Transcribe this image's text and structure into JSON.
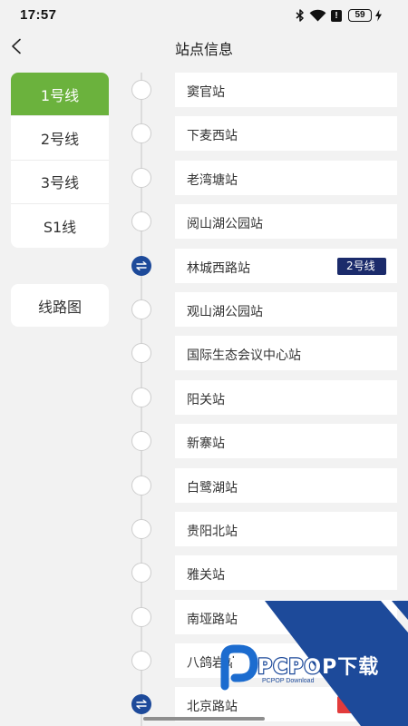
{
  "status_bar": {
    "time": "17:57",
    "alert_glyph": "!",
    "battery_level": "59",
    "icons": [
      "bluetooth-icon",
      "wifi-icon",
      "alert-icon",
      "battery-icon",
      "charging-icon"
    ]
  },
  "header": {
    "back_icon": "chevron-left-icon",
    "title": "站点信息"
  },
  "line_tabs": [
    {
      "label": "1号线",
      "selected": true
    },
    {
      "label": "2号线",
      "selected": false
    },
    {
      "label": "3号线",
      "selected": false
    },
    {
      "label": "S1线",
      "selected": false
    }
  ],
  "map_button": {
    "label": "线路图"
  },
  "stations": [
    {
      "name": "窦官站",
      "transfer": false
    },
    {
      "name": "下麦西站",
      "transfer": false
    },
    {
      "name": "老湾塘站",
      "transfer": false
    },
    {
      "name": "阅山湖公园站",
      "transfer": false
    },
    {
      "name": "林城西路站",
      "transfer": true,
      "transfer_icon": "transfer-icon",
      "transfer_line": "2号线",
      "badge_color": "#1b2b6b"
    },
    {
      "name": "观山湖公园站",
      "transfer": false
    },
    {
      "name": "国际生态会议中心站",
      "transfer": false
    },
    {
      "name": "阳关站",
      "transfer": false
    },
    {
      "name": "新寨站",
      "transfer": false
    },
    {
      "name": "白鹭湖站",
      "transfer": false
    },
    {
      "name": "贵阳北站",
      "transfer": false
    },
    {
      "name": "雅关站",
      "transfer": false
    },
    {
      "name": "南垭路站",
      "transfer": false
    },
    {
      "name": "八鸽岩站",
      "transfer": false
    },
    {
      "name": "北京路站",
      "transfer": true,
      "transfer_icon": "transfer-icon",
      "transfer_line": "3",
      "badge_color": "#e23b3b"
    }
  ],
  "colors": {
    "selected_tab": "#6bb23d",
    "transfer_node": "#1d4a9a",
    "page_background": "#f2f2f2"
  },
  "watermark": {
    "logo_icon": "pcpop-logo-icon",
    "brand": "PCPOP下载",
    "subtitle": "PCPOP Download"
  }
}
